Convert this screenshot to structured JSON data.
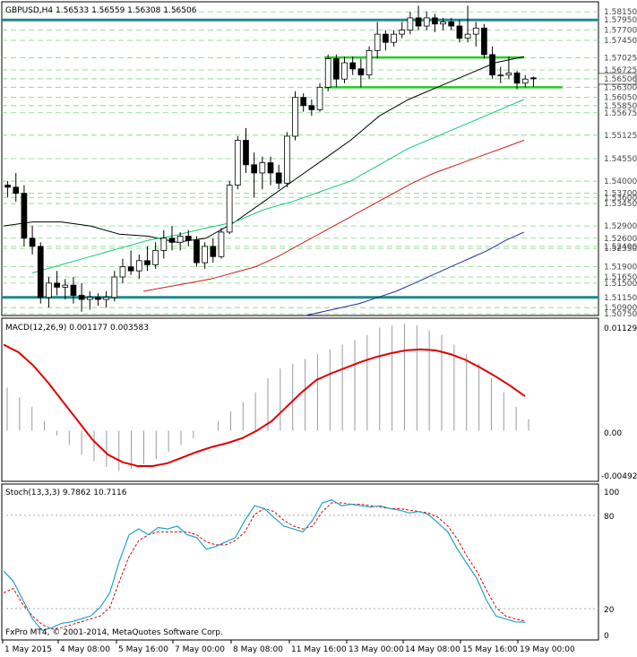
{
  "header": {
    "symbol": "GBPUSD,H4",
    "ohlc": "1.56533 1.56559 1.56308 1.56506"
  },
  "macd": {
    "title": "MACD(12,26,9) 0.001177 0.003583",
    "ticks": [
      "0.011295",
      "0.00",
      "-0.004923"
    ]
  },
  "stoch": {
    "title": "Stoch(13,3,3) 9.7862 10.7116",
    "ticks": [
      "100",
      "80",
      "20",
      "0"
    ]
  },
  "watermark": "FxPro MT4, © 2001-2014, MetaQuotes Software Corp.",
  "chart_data": [
    {
      "type": "candlestick",
      "title": "GBPUSD,H4",
      "ylim": [
        1.5075,
        1.5835
      ],
      "price_labels": [
        "1.58150",
        "1.57950",
        "1.57700",
        "1.57450",
        "1.57025",
        "1.56725",
        "1.56506",
        "1.56300",
        "1.56050",
        "1.55850",
        "1.55675",
        "1.55125",
        "1.54550",
        "1.54000",
        "1.53700",
        "1.53600",
        "1.53450",
        "1.52900",
        "1.52600",
        "1.52400",
        "1.52350",
        "1.51900",
        "1.51650",
        "1.51500",
        "1.51150",
        "1.50900",
        "1.50750"
      ],
      "current_price": "1.56506",
      "horizontal_levels": {
        "teal": [
          1.5795,
          1.5115
        ],
        "green": [
          1.5703,
          1.563
        ]
      },
      "x_labels": [
        "1 May 2015",
        "4 May 08:00",
        "5 May 16:00",
        "7 May 00:00",
        "8 May 08:00",
        "11 May 16:00",
        "13 May 00:00",
        "14 May 08:00",
        "15 May 16:00",
        "19 May 00:00"
      ],
      "candles": [
        [
          1.539,
          1.54,
          1.536,
          1.5385
        ],
        [
          1.5385,
          1.542,
          1.535,
          1.537
        ],
        [
          1.537,
          1.539,
          1.524,
          1.526
        ],
        [
          1.526,
          1.529,
          1.522,
          1.524
        ],
        [
          1.524,
          1.525,
          1.51,
          1.5115
        ],
        [
          1.5115,
          1.5165,
          1.509,
          1.515
        ],
        [
          1.515,
          1.518,
          1.512,
          1.514
        ],
        [
          1.514,
          1.516,
          1.511,
          1.5145
        ],
        [
          1.5145,
          1.5165,
          1.51,
          1.512
        ],
        [
          1.512,
          1.515,
          1.508,
          1.511
        ],
        [
          1.511,
          1.513,
          1.5085,
          1.5115
        ],
        [
          1.5115,
          1.5125,
          1.5095,
          1.511
        ],
        [
          1.511,
          1.513,
          1.509,
          1.5115
        ],
        [
          1.5115,
          1.518,
          1.5105,
          1.5165
        ],
        [
          1.5165,
          1.521,
          1.515,
          1.519
        ],
        [
          1.519,
          1.523,
          1.517,
          1.518
        ],
        [
          1.518,
          1.522,
          1.516,
          1.5205
        ],
        [
          1.5205,
          1.524,
          1.518,
          1.5195
        ],
        [
          1.5195,
          1.525,
          1.5185,
          1.523
        ],
        [
          1.523,
          1.528,
          1.521,
          1.526
        ],
        [
          1.526,
          1.529,
          1.523,
          1.525
        ],
        [
          1.525,
          1.5275,
          1.523,
          1.5265
        ],
        [
          1.5265,
          1.528,
          1.524,
          1.5255
        ],
        [
          1.5255,
          1.5265,
          1.519,
          1.52
        ],
        [
          1.52,
          1.525,
          1.5185,
          1.524
        ],
        [
          1.524,
          1.526,
          1.52,
          1.5215
        ],
        [
          1.5215,
          1.5285,
          1.521,
          1.5275
        ],
        [
          1.5275,
          1.54,
          1.527,
          1.539
        ],
        [
          1.539,
          1.551,
          1.538,
          1.55
        ],
        [
          1.55,
          1.553,
          1.542,
          1.544
        ],
        [
          1.544,
          1.547,
          1.536,
          1.542
        ],
        [
          1.542,
          1.546,
          1.538,
          1.5445
        ],
        [
          1.5445,
          1.546,
          1.539,
          1.542
        ],
        [
          1.542,
          1.544,
          1.538,
          1.5395
        ],
        [
          1.5395,
          1.552,
          1.5385,
          1.551
        ],
        [
          1.551,
          1.562,
          1.55,
          1.5605
        ],
        [
          1.5605,
          1.5615,
          1.557,
          1.5585
        ],
        [
          1.5585,
          1.56,
          1.556,
          1.5575
        ],
        [
          1.5575,
          1.564,
          1.557,
          1.563
        ],
        [
          1.563,
          1.571,
          1.562,
          1.57
        ],
        [
          1.57,
          1.571,
          1.563,
          1.565
        ],
        [
          1.565,
          1.5705,
          1.564,
          1.569
        ],
        [
          1.569,
          1.5705,
          1.566,
          1.5675
        ],
        [
          1.5675,
          1.57,
          1.563,
          1.566
        ],
        [
          1.566,
          1.573,
          1.565,
          1.572
        ],
        [
          1.572,
          1.579,
          1.57,
          1.576
        ],
        [
          1.576,
          1.577,
          1.572,
          1.574
        ],
        [
          1.574,
          1.577,
          1.573,
          1.576
        ],
        [
          1.576,
          1.579,
          1.575,
          1.577
        ],
        [
          1.577,
          1.5815,
          1.576,
          1.58
        ],
        [
          1.58,
          1.583,
          1.577,
          1.578
        ],
        [
          1.578,
          1.5815,
          1.577,
          1.58
        ],
        [
          1.58,
          1.581,
          1.5765,
          1.5785
        ],
        [
          1.5785,
          1.58,
          1.577,
          1.579
        ],
        [
          1.579,
          1.58,
          1.577,
          1.578
        ],
        [
          1.578,
          1.5795,
          1.574,
          1.575
        ],
        [
          1.575,
          1.583,
          1.574,
          1.576
        ],
        [
          1.576,
          1.579,
          1.573,
          1.5775
        ],
        [
          1.5775,
          1.5785,
          1.57,
          1.571
        ],
        [
          1.571,
          1.573,
          1.565,
          1.566
        ],
        [
          1.566,
          1.568,
          1.564,
          1.566
        ],
        [
          1.566,
          1.5705,
          1.565,
          1.5665
        ],
        [
          1.5665,
          1.567,
          1.5625,
          1.564
        ],
        [
          1.564,
          1.566,
          1.563,
          1.565
        ],
        [
          1.5653,
          1.5656,
          1.5631,
          1.5651
        ]
      ],
      "moving_averages": [
        {
          "color": "#000000",
          "values": [
            1.529,
            1.53,
            1.53,
            1.529,
            1.527,
            1.5265,
            1.525,
            1.526,
            1.53,
            1.535,
            1.54,
            1.545,
            1.55,
            1.556,
            1.56,
            1.563,
            1.566,
            1.569,
            1.5705
          ]
        },
        {
          "color": "#16c97a",
          "values": [
            1.5175,
            1.5195,
            1.5215,
            1.5235,
            1.5255,
            1.5268,
            1.5285,
            1.53,
            1.533,
            1.535,
            1.5375,
            1.54,
            1.544,
            1.548,
            1.551,
            1.554,
            1.557,
            1.56
          ]
        },
        {
          "color": "#cc2020",
          "values": [
            1.513,
            1.514,
            1.515,
            1.516,
            1.5175,
            1.519,
            1.5215,
            1.5245,
            1.5275,
            1.5305,
            1.5335,
            1.5365,
            1.5395,
            1.542,
            1.544,
            1.546,
            1.548,
            1.55
          ]
        },
        {
          "color": "#2030a0",
          "values": [
            1.507,
            1.508,
            1.509,
            1.51,
            1.5115,
            1.513,
            1.515,
            1.517,
            1.519,
            1.521,
            1.523,
            1.5255,
            1.5275
          ]
        }
      ]
    },
    {
      "type": "macd",
      "title": "MACD(12,26,9) 0.001177 0.003583",
      "ylim": [
        -0.004923,
        0.011295
      ],
      "histogram": [
        0.0045,
        0.0035,
        0.0025,
        0.001,
        -0.0005,
        -0.0015,
        -0.0025,
        -0.0032,
        -0.0038,
        -0.0042,
        -0.004,
        -0.0035,
        -0.003,
        -0.0022,
        -0.0015,
        -0.0008,
        0.0,
        0.001,
        0.002,
        0.003,
        0.004,
        0.0055,
        0.0065,
        0.007,
        0.0075,
        0.008,
        0.0085,
        0.009,
        0.0095,
        0.01,
        0.0108,
        0.011,
        0.0112,
        0.011,
        0.0105,
        0.01,
        0.009,
        0.008,
        0.007,
        0.0055,
        0.004,
        0.0025,
        0.0012
      ],
      "signal": [
        0.009,
        0.0082,
        0.0068,
        0.005,
        0.003,
        0.001,
        -0.001,
        -0.0025,
        -0.0033,
        -0.0037,
        -0.0037,
        -0.0034,
        -0.0028,
        -0.0022,
        -0.0017,
        -0.0013,
        -0.0008,
        0.0,
        0.001,
        0.0025,
        0.004,
        0.0053,
        0.006,
        0.0066,
        0.0072,
        0.0077,
        0.0081,
        0.0084,
        0.0085,
        0.0084,
        0.008,
        0.0074,
        0.0066,
        0.0057,
        0.0047,
        0.0036
      ]
    },
    {
      "type": "stochastic",
      "title": "Stoch(13,3,3) 9.7862 10.7116",
      "ylim": [
        0,
        100
      ],
      "main": [
        45,
        38,
        25,
        12,
        4,
        6,
        9,
        10,
        12,
        14,
        20,
        30,
        52,
        70,
        74,
        70,
        75,
        74,
        76,
        70,
        68,
        60,
        62,
        65,
        68,
        80,
        90,
        88,
        82,
        76,
        74,
        72,
        80,
        92,
        94,
        90,
        91,
        90,
        89,
        90,
        88,
        87,
        85,
        86,
        84,
        78,
        72,
        60,
        50,
        40,
        25,
        14,
        12,
        10,
        9.8
      ],
      "signal": [
        30,
        33,
        22,
        14,
        8,
        5,
        6,
        8,
        10,
        12,
        14,
        20,
        38,
        55,
        66,
        70,
        72,
        72,
        72,
        72,
        70,
        65,
        63,
        63,
        66,
        72,
        84,
        88,
        86,
        80,
        76,
        74,
        76,
        86,
        92,
        92,
        91,
        91,
        90,
        89,
        88,
        88,
        87,
        86,
        85,
        82,
        76,
        67,
        55,
        45,
        32,
        20,
        14,
        12,
        10.7
      ]
    }
  ]
}
